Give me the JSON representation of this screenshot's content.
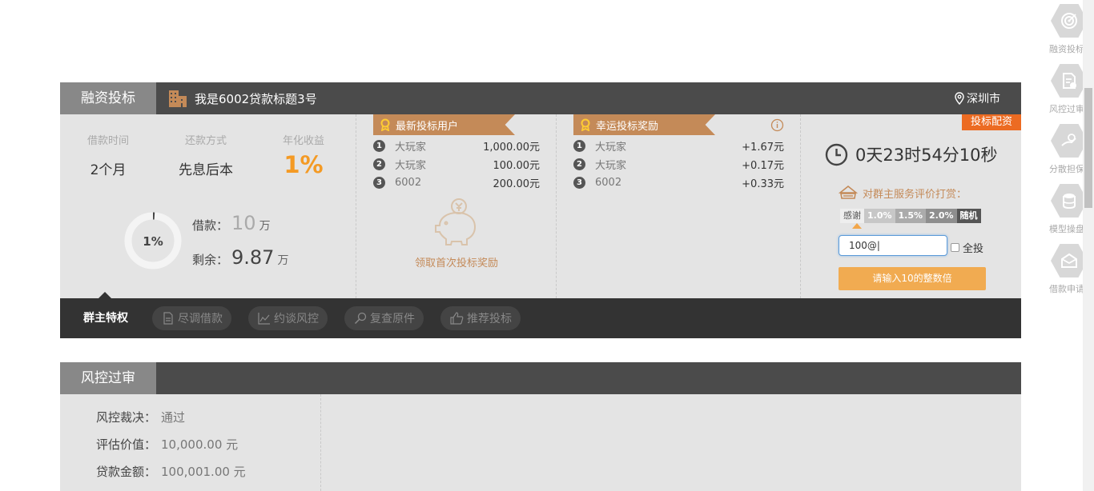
{
  "panel": {
    "tab_label": "融资投标",
    "loan_title": "我是6002贷款标题3号",
    "location": "深圳市"
  },
  "summary": {
    "term_label": "借款时间",
    "term_value": "2个月",
    "repay_label": "还款方式",
    "repay_value": "先息后本",
    "rate_label": "年化收益",
    "rate_value": "1%",
    "progress_text": "1%",
    "progress_fraction": 0.01,
    "borrow_label": "借款：",
    "borrow_amount": "10",
    "borrow_unit": "万",
    "remain_label": "剩余：",
    "remain_amount": "9.87",
    "remain_unit": "万"
  },
  "latest_investors": {
    "title": "最新投标用户",
    "rows": [
      {
        "rank": "1",
        "name": "大玩家",
        "amount": "1,000.00元"
      },
      {
        "rank": "2",
        "name": "大玩家",
        "amount": "100.00元"
      },
      {
        "rank": "3",
        "name": "6002",
        "amount": "200.00元"
      }
    ],
    "reward_link": "领取首次投标奖励"
  },
  "lucky_rewards": {
    "title": "幸运投标奖励",
    "rows": [
      {
        "rank": "1",
        "name": "大玩家",
        "amount": "+1.67元"
      },
      {
        "rank": "2",
        "name": "大玩家",
        "amount": "+0.17元"
      },
      {
        "rank": "3",
        "name": "6002",
        "amount": "+0.33元"
      }
    ]
  },
  "invest_box": {
    "corner_tag": "投标配资",
    "countdown": "0天23时54分10秒",
    "tip": "对群主服务评价打赏：",
    "options": [
      "感谢",
      "1.0%",
      "1.5%",
      "2.0%",
      "随机"
    ],
    "input_value": "100@|",
    "all_in_label": "全投",
    "submit_label": "请输入10的整数倍"
  },
  "tabs": {
    "active": "群主特权",
    "items": [
      "尽调借款",
      "约谈风控",
      "复查原件",
      "推荐投标"
    ]
  },
  "risk_panel": {
    "tab_label": "风控过审",
    "rows": [
      {
        "key": "风控裁决：",
        "value": "通过"
      },
      {
        "key": "评估价值：",
        "value": "10,000.00 元"
      },
      {
        "key": "贷款金额：",
        "value": "100,001.00 元"
      }
    ]
  },
  "side_nav": [
    {
      "label": "融资投标",
      "icon": "target-icon"
    },
    {
      "label": "风控过审",
      "icon": "document-check-icon"
    },
    {
      "label": "分散担保",
      "icon": "hand-coin-icon"
    },
    {
      "label": "模型操盘",
      "icon": "database-icon"
    },
    {
      "label": "借款申请",
      "icon": "envelope-icon"
    }
  ],
  "colors": {
    "accent_orange": "#f49a24",
    "ribbon_brown": "#c48a58",
    "corner_tag": "#ec6b22",
    "submit_button": "#f1ab51",
    "header_dark": "#4b4b4b"
  }
}
